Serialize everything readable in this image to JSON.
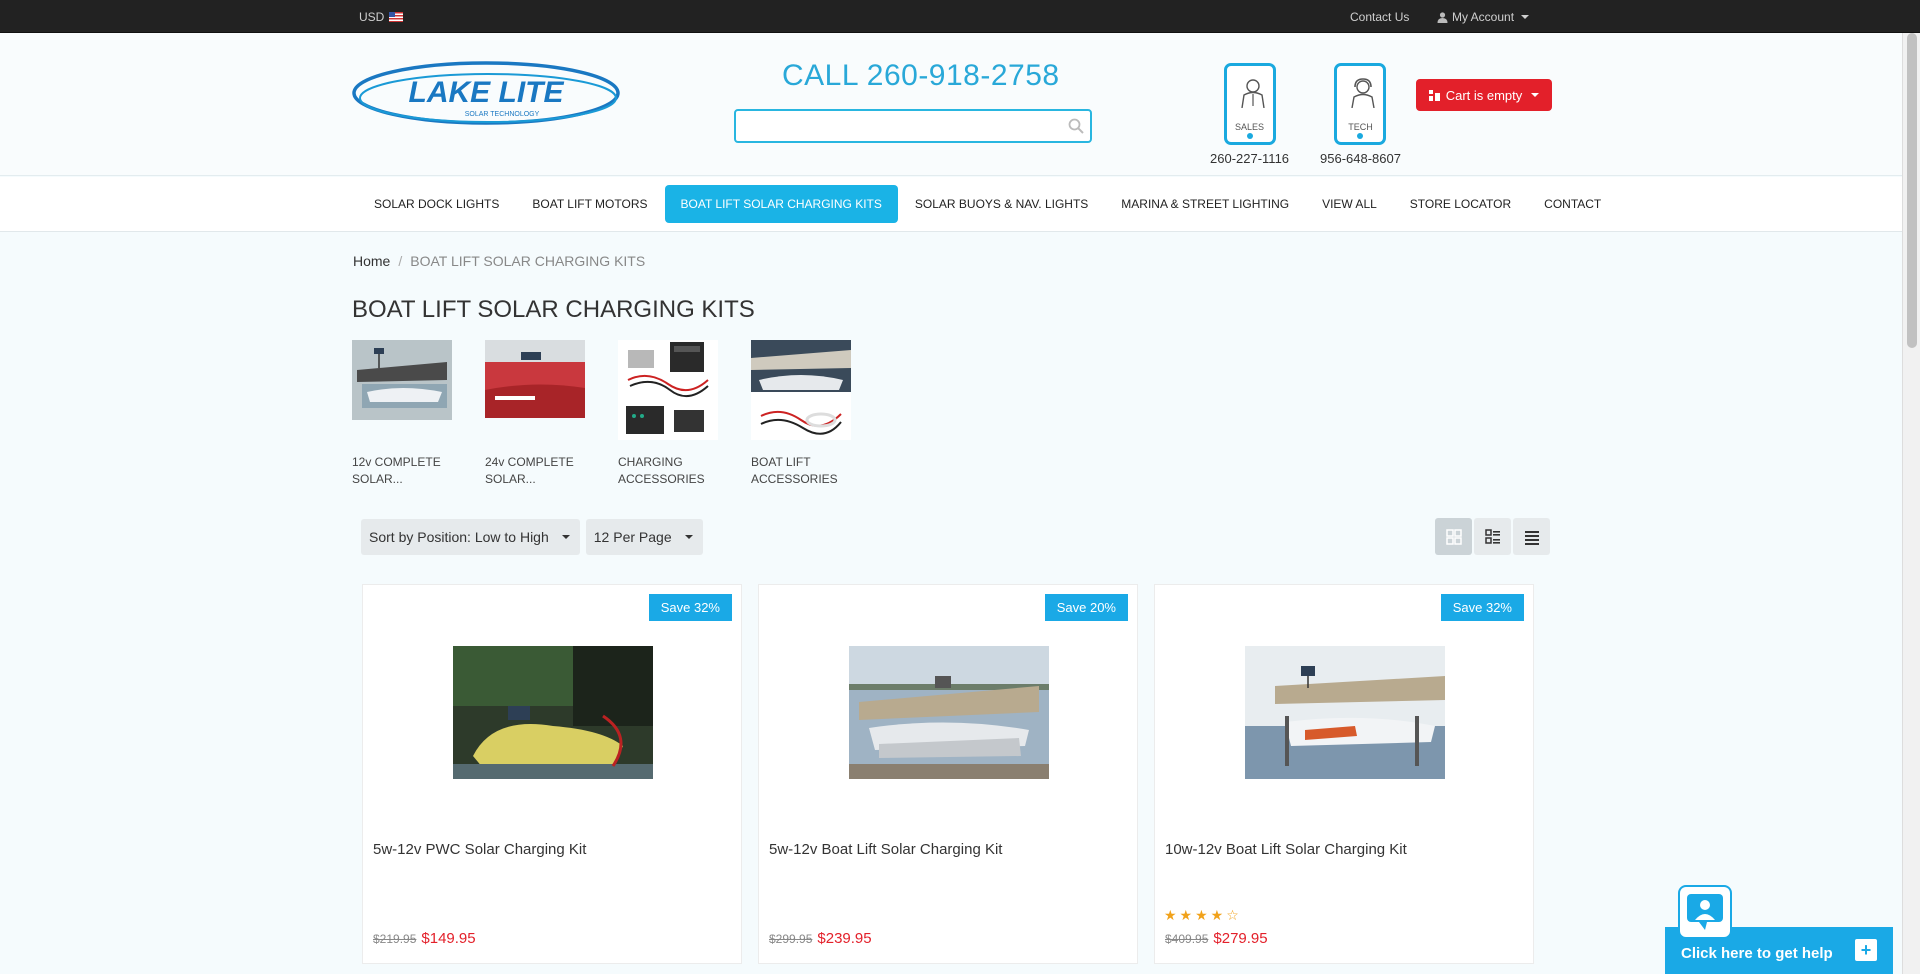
{
  "topbar": {
    "currency": "USD",
    "contact_label": "Contact Us",
    "account_label": "My Account"
  },
  "header": {
    "call": "CALL 260-918-2758",
    "search_placeholder": "",
    "sales_label": "SALES",
    "sales_phone": "260-227-1116",
    "tech_label": "TECH",
    "tech_phone": "956-648-8607",
    "cart_label": "Cart is empty",
    "logo_text": "LAKE LITE",
    "logo_sub": "SOLAR TECHNOLOGY"
  },
  "nav": {
    "items": [
      "SOLAR DOCK LIGHTS",
      "BOAT LIFT MOTORS",
      "BOAT LIFT SOLAR CHARGING KITS",
      "SOLAR BUOYS & NAV. LIGHTS",
      "MARINA & STREET LIGHTING",
      "VIEW ALL",
      "STORE LOCATOR",
      "CONTACT"
    ],
    "active_index": 2
  },
  "breadcrumb": {
    "home": "Home",
    "separator": "/",
    "current": "BOAT LIFT SOLAR CHARGING KITS"
  },
  "page_title": "BOAT LIFT SOLAR CHARGING KITS",
  "categories": [
    {
      "line1": "12v COMPLETE",
      "line2": "SOLAR..."
    },
    {
      "line1": "24v COMPLETE",
      "line2": "SOLAR..."
    },
    {
      "line1": "CHARGING",
      "line2": "ACCESSORIES"
    },
    {
      "line1": "BOAT LIFT",
      "line2": "ACCESSORIES"
    }
  ],
  "toolbar": {
    "sort_label": "Sort by Position: Low to High",
    "per_page_label": "12 Per Page"
  },
  "products": [
    {
      "badge": "Save 32%",
      "name": "5w-12v PWC Solar Charging Kit",
      "old_price": "$219.95",
      "new_price": "$149.95",
      "rating": null
    },
    {
      "badge": "Save 20%",
      "name": "5w-12v Boat Lift Solar Charging Kit",
      "old_price": "$299.95",
      "new_price": "$239.95",
      "rating": null
    },
    {
      "badge": "Save 32%",
      "name": "10w-12v Boat Lift Solar Charging Kit",
      "old_price": "$409.95",
      "new_price": "$279.95",
      "rating": "★★★★☆"
    }
  ],
  "help": {
    "label": "Click here to get help",
    "plus": "+"
  },
  "colors": {
    "accent": "#1ab3e6",
    "cart": "#e3202a",
    "price": "#e3202a",
    "topbar": "#222222"
  }
}
